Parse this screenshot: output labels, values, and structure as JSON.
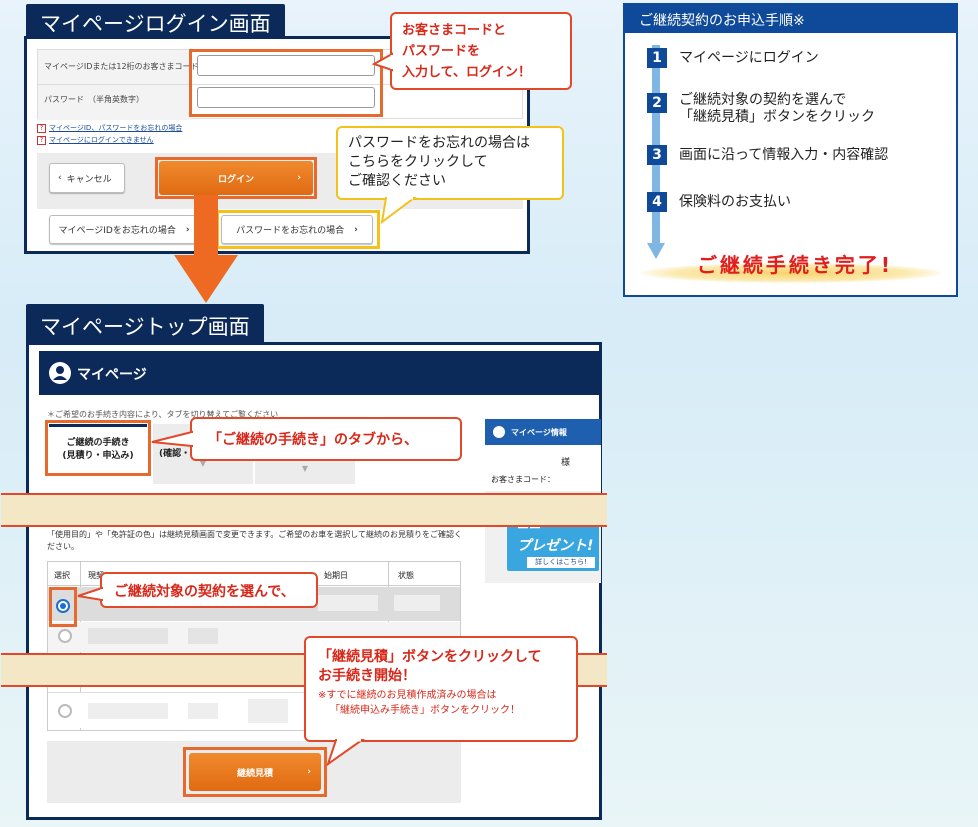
{
  "login": {
    "title": "マイページログイン画面",
    "id_label": "マイページIDまたは12桁のお客さまコード",
    "password_label": "パスワード　（半角英数字）",
    "help_link_1": "マイページID、パスワードをお忘れの場合",
    "help_link_2": "マイページにログインできません",
    "cancel_label": "キャンセル",
    "login_label": "ログイン",
    "forgot_id_label": "マイページIDをお忘れの場合",
    "forgot_password_label": "パスワードをお忘れの場合",
    "callout_enter_line1": "お客さまコードと",
    "callout_enter_line2": "パスワードを",
    "callout_enter_line3": "入力して、ログイン！",
    "callout_forgot_line1": "パスワードをお忘れの場合は",
    "callout_forgot_line2": "こちらをクリックして",
    "callout_forgot_line3": "ご確認ください"
  },
  "steps": {
    "heading": "ご継続契約のお申込手順※",
    "items": [
      {
        "num": "1",
        "line1": "マイページにログイン",
        "line2": ""
      },
      {
        "num": "2",
        "line1": "ご継続対象の契約を選んで",
        "line2": "「継続見積」ボタンをクリック"
      },
      {
        "num": "3",
        "line1": "画面に沿って情報入力・内容確認",
        "line2": ""
      },
      {
        "num": "4",
        "line1": "保険料のお支払い",
        "line2": ""
      }
    ],
    "complete": "ご継続手続き完了!"
  },
  "mypage": {
    "title": "マイページトップ画面",
    "header": "マイページ",
    "notice": "＊ご希望のお手続き内容により、タブを切り替えてご覧ください",
    "tab1_line1": "ご継続の手続き",
    "tab1_line2": "(見積り・申込み)",
    "tab2_line2": "(確認・",
    "info_header": "マイページ情報",
    "info_name_suffix": "様",
    "info_customer_code": "お客さまコード：",
    "banner_text1": "ーー",
    "banner_text2": "プレゼント!",
    "banner_link": "詳しくはこちら!",
    "usage_note": "「使用目的」や「免許証の色」は継続見積画面で変更できます。ご希望のお車を選択して継続のお見積りをご確認ください。",
    "col_select": "選択",
    "col_current": "現契",
    "col_expiry": "始期日",
    "col_status": "状態",
    "quote_button": "継続見積",
    "callout_tab": "「ご継続の手続き」のタブから、",
    "callout_select": "ご継続対象の契約を選んで、",
    "callout_quote_line1": "「継続見積」ボタンをクリックして",
    "callout_quote_line2": "お手続き開始！",
    "callout_quote_note1": "※すでに継続のお見積作成済みの場合は",
    "callout_quote_note2": "「継続申込み手続き」ボタンをクリック！"
  }
}
